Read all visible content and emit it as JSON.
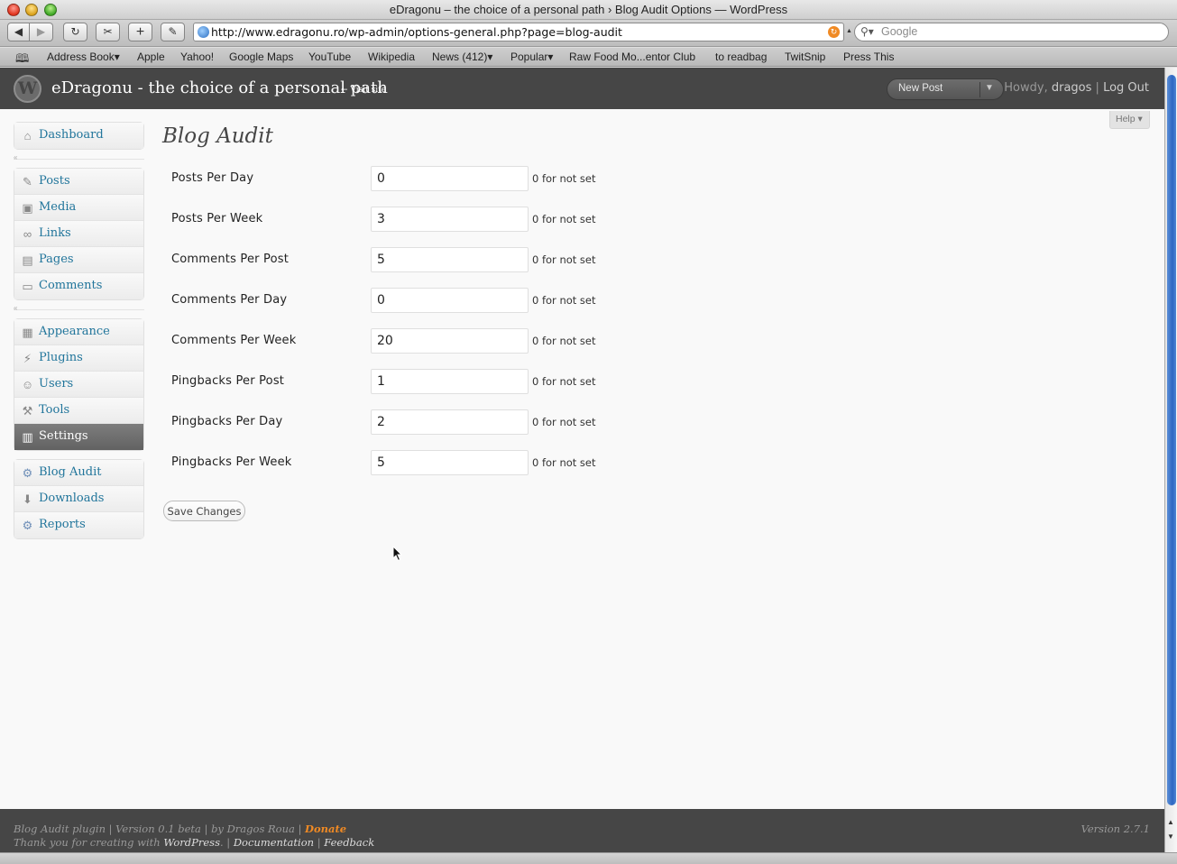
{
  "window": {
    "title": "eDragonu – the choice of a personal path › Blog Audit Options — WordPress"
  },
  "browser": {
    "url": "http://www.edragonu.ro/wp-admin/options-general.php?page=blog-audit",
    "search_placeholder": "Google",
    "bookmarks": [
      "Address Book",
      "Apple",
      "Yahoo!",
      "Google Maps",
      "YouTube",
      "Wikipedia",
      "News (412)",
      "Popular",
      "Raw Food Mo...entor Club",
      "to readbag",
      "TwitSnip",
      "Press This"
    ]
  },
  "header": {
    "site_title": "eDragonu - the choice of a personal path",
    "visit_site": "← Visit site",
    "new_post": "New Post",
    "howdy": "Howdy,",
    "username": "dragos",
    "separator": "|",
    "logout": "Log Out"
  },
  "help": "Help",
  "menu": {
    "group1": [
      {
        "label": "Dashboard",
        "icon": "house-icon"
      }
    ],
    "group2": [
      {
        "label": "Posts",
        "icon": "pushpin-icon"
      },
      {
        "label": "Media",
        "icon": "media-icon"
      },
      {
        "label": "Links",
        "icon": "link-icon"
      },
      {
        "label": "Pages",
        "icon": "pages-icon"
      },
      {
        "label": "Comments",
        "icon": "comment-icon"
      }
    ],
    "group3": [
      {
        "label": "Appearance",
        "icon": "appearance-icon"
      },
      {
        "label": "Plugins",
        "icon": "plugin-icon"
      },
      {
        "label": "Users",
        "icon": "users-icon"
      },
      {
        "label": "Tools",
        "icon": "tools-icon"
      },
      {
        "label": "Settings",
        "icon": "settings-icon"
      }
    ],
    "group4": [
      {
        "label": "Blog Audit",
        "icon": "gear-icon"
      },
      {
        "label": "Downloads",
        "icon": "download-icon"
      },
      {
        "label": "Reports",
        "icon": "gear-icon"
      }
    ]
  },
  "page": {
    "title": "Blog Audit",
    "hint": "0 for not set",
    "fields": [
      {
        "label": "Posts Per Day",
        "value": "0"
      },
      {
        "label": "Posts Per Week",
        "value": "3"
      },
      {
        "label": "Comments Per Post",
        "value": "5"
      },
      {
        "label": "Comments Per Day",
        "value": "0"
      },
      {
        "label": "Comments Per Week",
        "value": "20"
      },
      {
        "label": "Pingbacks Per Post",
        "value": "1"
      },
      {
        "label": "Pingbacks Per Day",
        "value": "2"
      },
      {
        "label": "Pingbacks Per Week",
        "value": "5"
      }
    ],
    "save_label": "Save Changes"
  },
  "footer": {
    "plugin_text": "Blog Audit plugin | Version 0.1 beta | by Dragos Roua |",
    "donate": "Donate",
    "thanks": "Thank you for creating with",
    "wordpress": "WordPress",
    "documentation": "Documentation",
    "feedback": "Feedback",
    "version": "Version 2.7.1"
  },
  "colors": {
    "accent": "#21759b",
    "header_bg": "#464646",
    "donate": "#f08a24"
  }
}
